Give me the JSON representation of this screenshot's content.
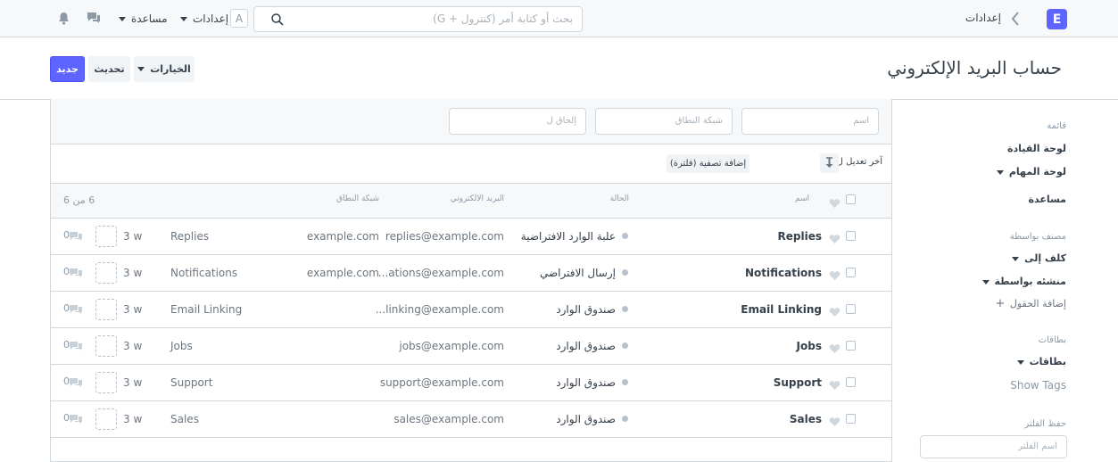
{
  "navbar": {
    "logo": "E",
    "breadcrumb": "إعدادات",
    "search_placeholder": "بحث أو كتابة أمر (كنترول + G)",
    "avatar_initial": "A",
    "settings_label": "إعدادات",
    "help_label": "مساعدة"
  },
  "page": {
    "title": "حساب البريد الإلكتروني",
    "new_label": "جديد",
    "refresh_label": "تحديث",
    "options_label": "الخيارات"
  },
  "sidebar": {
    "list_label": "قائمة",
    "dashboard": "لوحة القيادة",
    "tasks": "لوحة المهام",
    "help": "مساعدة",
    "classified_by": "مصنف بواسطة",
    "assigned_to": "كلف إلى",
    "created_by": "منشئه بواسطة",
    "add_fields": "إضافة الحقول",
    "tags_label": "بطاقات",
    "tags_dropdown": "بطاقات",
    "show_tags": "Show Tags",
    "save_filter_label": "حفظ الفلتر",
    "filter_name_placeholder": "اسم الفلتر"
  },
  "filters": {
    "name_placeholder": "اسم",
    "domain_placeholder": "شبكة النطاق",
    "append_to_placeholder": "إلحاق ل",
    "sort_label": "آخر تعديل ل",
    "add_filter": "إضافة تصفية (فلترة)"
  },
  "table": {
    "headers": {
      "name": "اسم",
      "status": "الحالة",
      "email": "البريد الالكتروني",
      "domain": "شبكة النطاق",
      "count": "6 من 6"
    },
    "rows": [
      {
        "name": "Replies",
        "status": "علبة الوارد الافتراضية",
        "email": "replies@example.com",
        "domain": "example.com",
        "link": "Replies",
        "modified": "3 w",
        "comments": "0"
      },
      {
        "name": "Notifications",
        "status": "إرسال الافتراضي",
        "email": "...ations@example.com",
        "domain": "example.com",
        "link": "Notifications",
        "modified": "3 w",
        "comments": "0"
      },
      {
        "name": "Email Linking",
        "status": "صندوق الوارد",
        "email": "...linking@example.com",
        "domain": "",
        "link": "Email Linking",
        "modified": "3 w",
        "comments": "0"
      },
      {
        "name": "Jobs",
        "status": "صندوق الوارد",
        "email": "jobs@example.com",
        "domain": "",
        "link": "Jobs",
        "modified": "3 w",
        "comments": "0"
      },
      {
        "name": "Support",
        "status": "صندوق الوارد",
        "email": "support@example.com",
        "domain": "",
        "link": "Support",
        "modified": "3 w",
        "comments": "0"
      },
      {
        "name": "Sales",
        "status": "صندوق الوارد",
        "email": "sales@example.com",
        "domain": "",
        "link": "Sales",
        "modified": "3 w",
        "comments": "0"
      }
    ]
  }
}
